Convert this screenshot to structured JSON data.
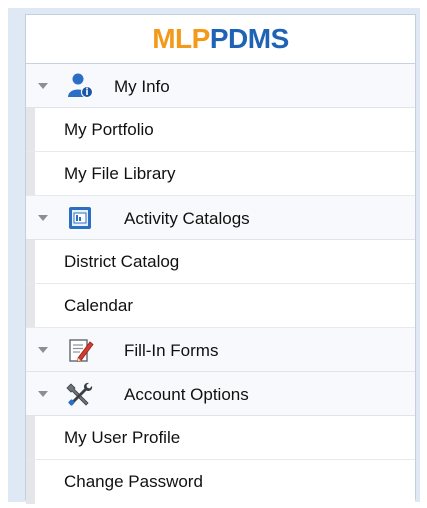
{
  "brand": {
    "part1": "MLP",
    "part2": "PDMS",
    "color1": "#f49a1a",
    "color2": "#1f63b6"
  },
  "groups": [
    {
      "label": "My Info",
      "icon": "user-info-icon",
      "items": [
        "My Portfolio",
        "My File Library"
      ]
    },
    {
      "label": "Activity Catalogs",
      "icon": "catalog-book-icon",
      "items": [
        "District Catalog",
        "Calendar"
      ]
    },
    {
      "label": "Fill-In Forms",
      "icon": "form-pencil-icon",
      "items": []
    },
    {
      "label": "Account Options",
      "icon": "tools-icon",
      "items": [
        "My User Profile",
        "Change Password"
      ]
    }
  ]
}
